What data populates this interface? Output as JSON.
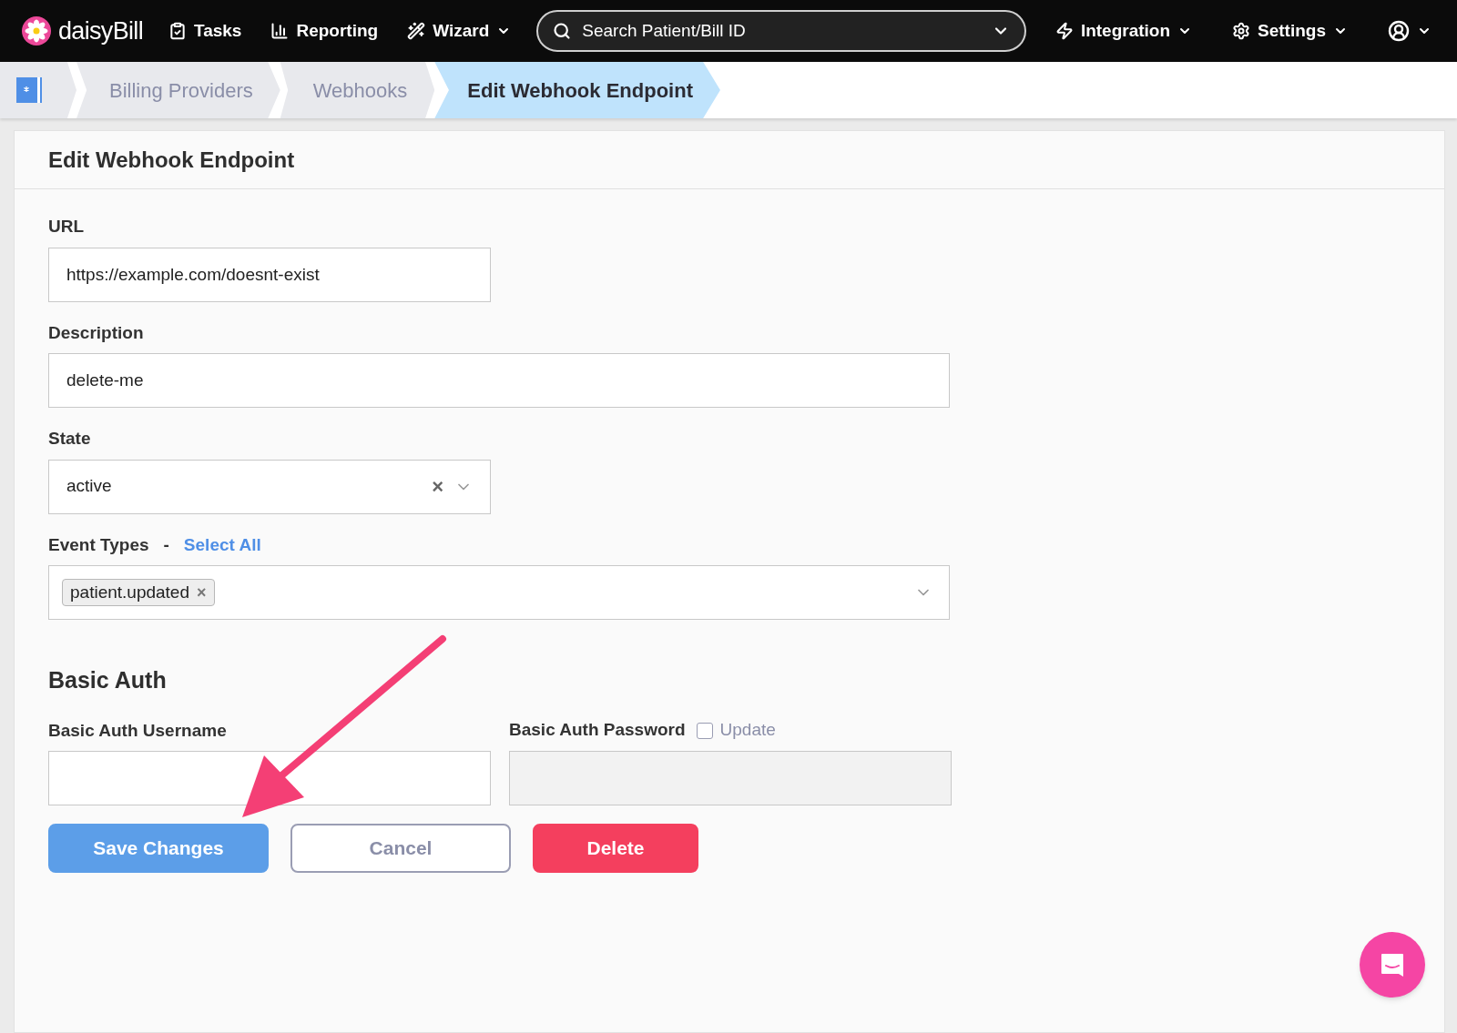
{
  "nav": {
    "logo": "daisy**Bill**",
    "items": [
      {
        "kind": "tasks",
        "label": "Tasks",
        "dropdown": false
      },
      {
        "kind": "reporting",
        "label": "Reporting",
        "dropdown": false
      },
      {
        "kind": "wizard",
        "label": "Wizard",
        "dropdown": true
      }
    ],
    "search": {
      "placeholder": "Search Patient/Bill ID"
    },
    "right_items": [
      {
        "kind": "integration",
        "label": "Integration",
        "dropdown": true
      },
      {
        "kind": "settings",
        "label": "Settings",
        "dropdown": true
      },
      {
        "kind": "account",
        "dropdown": true
      }
    ]
  },
  "breadcrumbs": [
    {
      "label": "Billing Providers",
      "selected": false
    },
    {
      "label": "Webhooks",
      "selected": false
    },
    {
      "label": "Edit Webhook Endpoint",
      "selected": true
    }
  ],
  "card": {
    "title": "Edit Webhook Endpoint",
    "url": {
      "label": "URL",
      "value": "https://example.com/doesnt-exist"
    },
    "description": {
      "label": "Description",
      "value": "delete-me"
    },
    "state": {
      "label": "State",
      "value": "active",
      "clear": "×"
    },
    "event_types": {
      "label": "Event Types",
      "separator": "-",
      "select_all": "Select All",
      "tags": [
        {
          "label": "patient.updated",
          "remove": "×"
        }
      ]
    },
    "basic_auth": {
      "title": "Basic Auth",
      "username": {
        "label": "Basic Auth Username"
      },
      "password": {
        "label": "Basic Auth Password",
        "update": {
          "label": "Update",
          "checked": false
        },
        "disabled": true
      }
    },
    "buttons": [
      {
        "kind": "primary",
        "label": "Save Changes"
      },
      {
        "kind": "secondary",
        "label": "Cancel"
      },
      {
        "kind": "danger",
        "label": "Delete"
      }
    ]
  }
}
